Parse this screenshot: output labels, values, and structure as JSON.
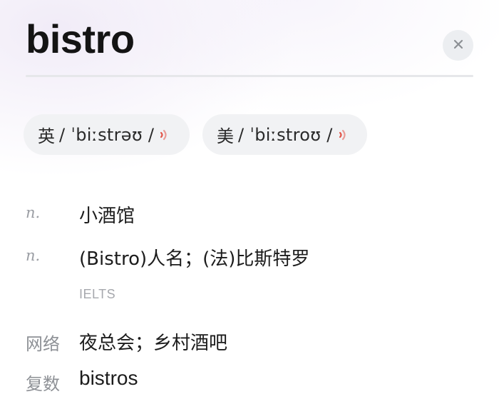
{
  "word": "bistro",
  "close_icon": "close-icon",
  "pronunciations": [
    {
      "label": "英",
      "phonetic": "/ ˈbiːstrəʊ /",
      "icon": "speaker-icon",
      "icon_color": "#e2564a"
    },
    {
      "label": "美",
      "phonetic": "/ ˈbiːstroʊ /",
      "icon": "speaker-icon",
      "icon_color": "#e2564a"
    }
  ],
  "definitions": [
    {
      "pos": "n.",
      "text": "小酒馆"
    },
    {
      "pos": "n.",
      "text": "(Bistro)人名；(法)比斯特罗"
    }
  ],
  "exam_tag": "IELTS",
  "web": {
    "label": "网络",
    "value": "夜总会；乡村酒吧"
  },
  "plural": {
    "label": "复数",
    "value": "bistros"
  }
}
